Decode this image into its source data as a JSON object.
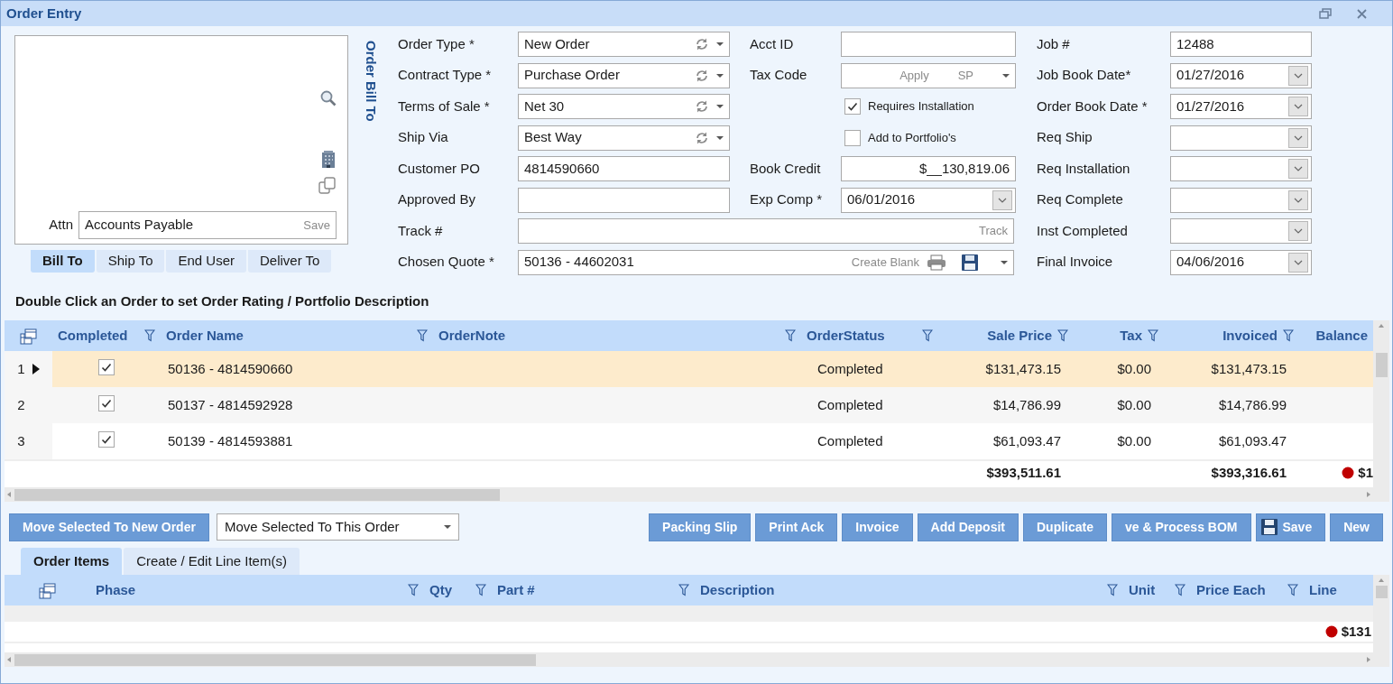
{
  "window": {
    "title": "Order Entry"
  },
  "bill_to": {
    "side_label": "Order Bill To",
    "attn_label": "Attn",
    "attn_value": "Accounts Payable",
    "attn_action": "Save",
    "tabs": [
      {
        "label": "Bill To",
        "selected": true
      },
      {
        "label": "Ship To",
        "selected": false
      },
      {
        "label": "End User",
        "selected": false
      },
      {
        "label": "Deliver To",
        "selected": false
      }
    ]
  },
  "form_rows": [
    [
      {
        "label": "Order Type *",
        "kind": "combo",
        "value": "New Order"
      },
      {
        "label": "Acct ID",
        "kind": "text"
      },
      {
        "label": "Job #",
        "kind": "text",
        "value": "12488"
      }
    ],
    [
      {
        "label": "Contract Type *",
        "kind": "combo",
        "value": "Purchase Order"
      },
      {
        "label": "Tax Code",
        "kind": "tax",
        "apply": "Apply",
        "code": "SP"
      },
      {
        "label": "Job Book Date*",
        "kind": "date",
        "value": "01/27/2016"
      }
    ],
    [
      {
        "label": "Terms of Sale *",
        "kind": "combo",
        "value": "Net 30"
      },
      {
        "label": "Requires Installation",
        "kind": "checkbox",
        "checked": true
      },
      {
        "label": "Order Book Date *",
        "kind": "date",
        "value": "01/27/2016"
      }
    ],
    [
      {
        "label": "Ship Via",
        "kind": "combo",
        "value": "Best Way"
      },
      {
        "label": "Add to Portfolio's",
        "kind": "checkbox",
        "checked": false
      },
      {
        "label": "Req Ship",
        "kind": "date"
      }
    ],
    [
      {
        "label": "Customer PO",
        "kind": "text",
        "value": "4814590660"
      },
      {
        "label": "Book Credit",
        "kind": "money",
        "value": "$__130,819.06"
      },
      {
        "label": "Req Installation",
        "kind": "date"
      }
    ],
    [
      {
        "label": "Approved By",
        "kind": "text"
      },
      {
        "label": "Exp Comp *",
        "kind": "date",
        "value": "06/01/2016"
      },
      {
        "label": "Req Complete",
        "kind": "date"
      }
    ],
    [
      {
        "label": "Track #",
        "kind": "track",
        "action": "Track"
      },
      {
        "label": "Inst Completed",
        "kind": "date"
      }
    ],
    [
      {
        "label": "Chosen Quote *",
        "kind": "quote",
        "value": "50136 - 44602031",
        "action": "Create Blank"
      },
      {
        "label": "Final Invoice",
        "kind": "date",
        "value": "04/06/2016"
      }
    ]
  ],
  "orders_hint": "Double Click an Order to set Order Rating / Portfolio Description",
  "orders": {
    "columns": [
      {
        "label": "Completed",
        "kind": "check",
        "filter": true
      },
      {
        "label": "Order Name",
        "kind": "text",
        "filter": true
      },
      {
        "label": "OrderNote",
        "kind": "text",
        "filter": true
      },
      {
        "label": "OrderStatus",
        "kind": "status",
        "filter": true
      },
      {
        "label": "Sale Price",
        "kind": "money",
        "filter": true
      },
      {
        "label": "Tax",
        "kind": "money",
        "filter": true
      },
      {
        "label": "Invoiced",
        "kind": "money",
        "filter": true
      },
      {
        "label": "Balance",
        "kind": "money",
        "filter": false
      }
    ],
    "rows": [
      {
        "number": "1",
        "selected": true,
        "completed": true,
        "order_name": "50136 - 4814590660",
        "status": "Completed",
        "sale_price": "$131,473.15",
        "tax": "$0.00",
        "invoiced": "$131,473.15"
      },
      {
        "number": "2",
        "selected": false,
        "completed": true,
        "order_name": "50137 - 4814592928",
        "status": "Completed",
        "sale_price": "$14,786.99",
        "tax": "$0.00",
        "invoiced": "$14,786.99"
      },
      {
        "number": "3",
        "selected": false,
        "completed": true,
        "order_name": "50139 - 4814593881",
        "status": "Completed",
        "sale_price": "$61,093.47",
        "tax": "$0.00",
        "invoiced": "$61,093.47"
      }
    ],
    "totals": {
      "sale_price": "$393,511.61",
      "invoiced": "$393,316.61",
      "balance": "$1"
    }
  },
  "actions": {
    "move_new": "Move Selected To New Order",
    "move_to": "Move Selected To This Order",
    "buttons": [
      {
        "label": "Packing Slip",
        "kind": "plain"
      },
      {
        "label": "Print Ack",
        "kind": "plain"
      },
      {
        "label": "Invoice",
        "kind": "plain"
      },
      {
        "label": "Add Deposit",
        "kind": "plain"
      },
      {
        "label": "Duplicate",
        "kind": "plain"
      },
      {
        "label": "ve & Process BOM",
        "kind": "plain"
      },
      {
        "label": "Save",
        "kind": "save"
      },
      {
        "label": "New",
        "kind": "plain"
      }
    ]
  },
  "items": {
    "tabs": [
      {
        "label": "Order Items",
        "selected": true
      },
      {
        "label": "Create / Edit Line Item(s)",
        "selected": false
      }
    ],
    "columns": [
      {
        "label": "Phase",
        "filter": true
      },
      {
        "label": "Qty",
        "filter": true
      },
      {
        "label": "Part #",
        "filter": true
      },
      {
        "label": "Description",
        "filter": true
      },
      {
        "label": "Unit",
        "filter": true
      },
      {
        "label": "Price Each",
        "filter": true
      },
      {
        "label": "Line",
        "filter": false
      }
    ],
    "line_total": "$131"
  }
}
